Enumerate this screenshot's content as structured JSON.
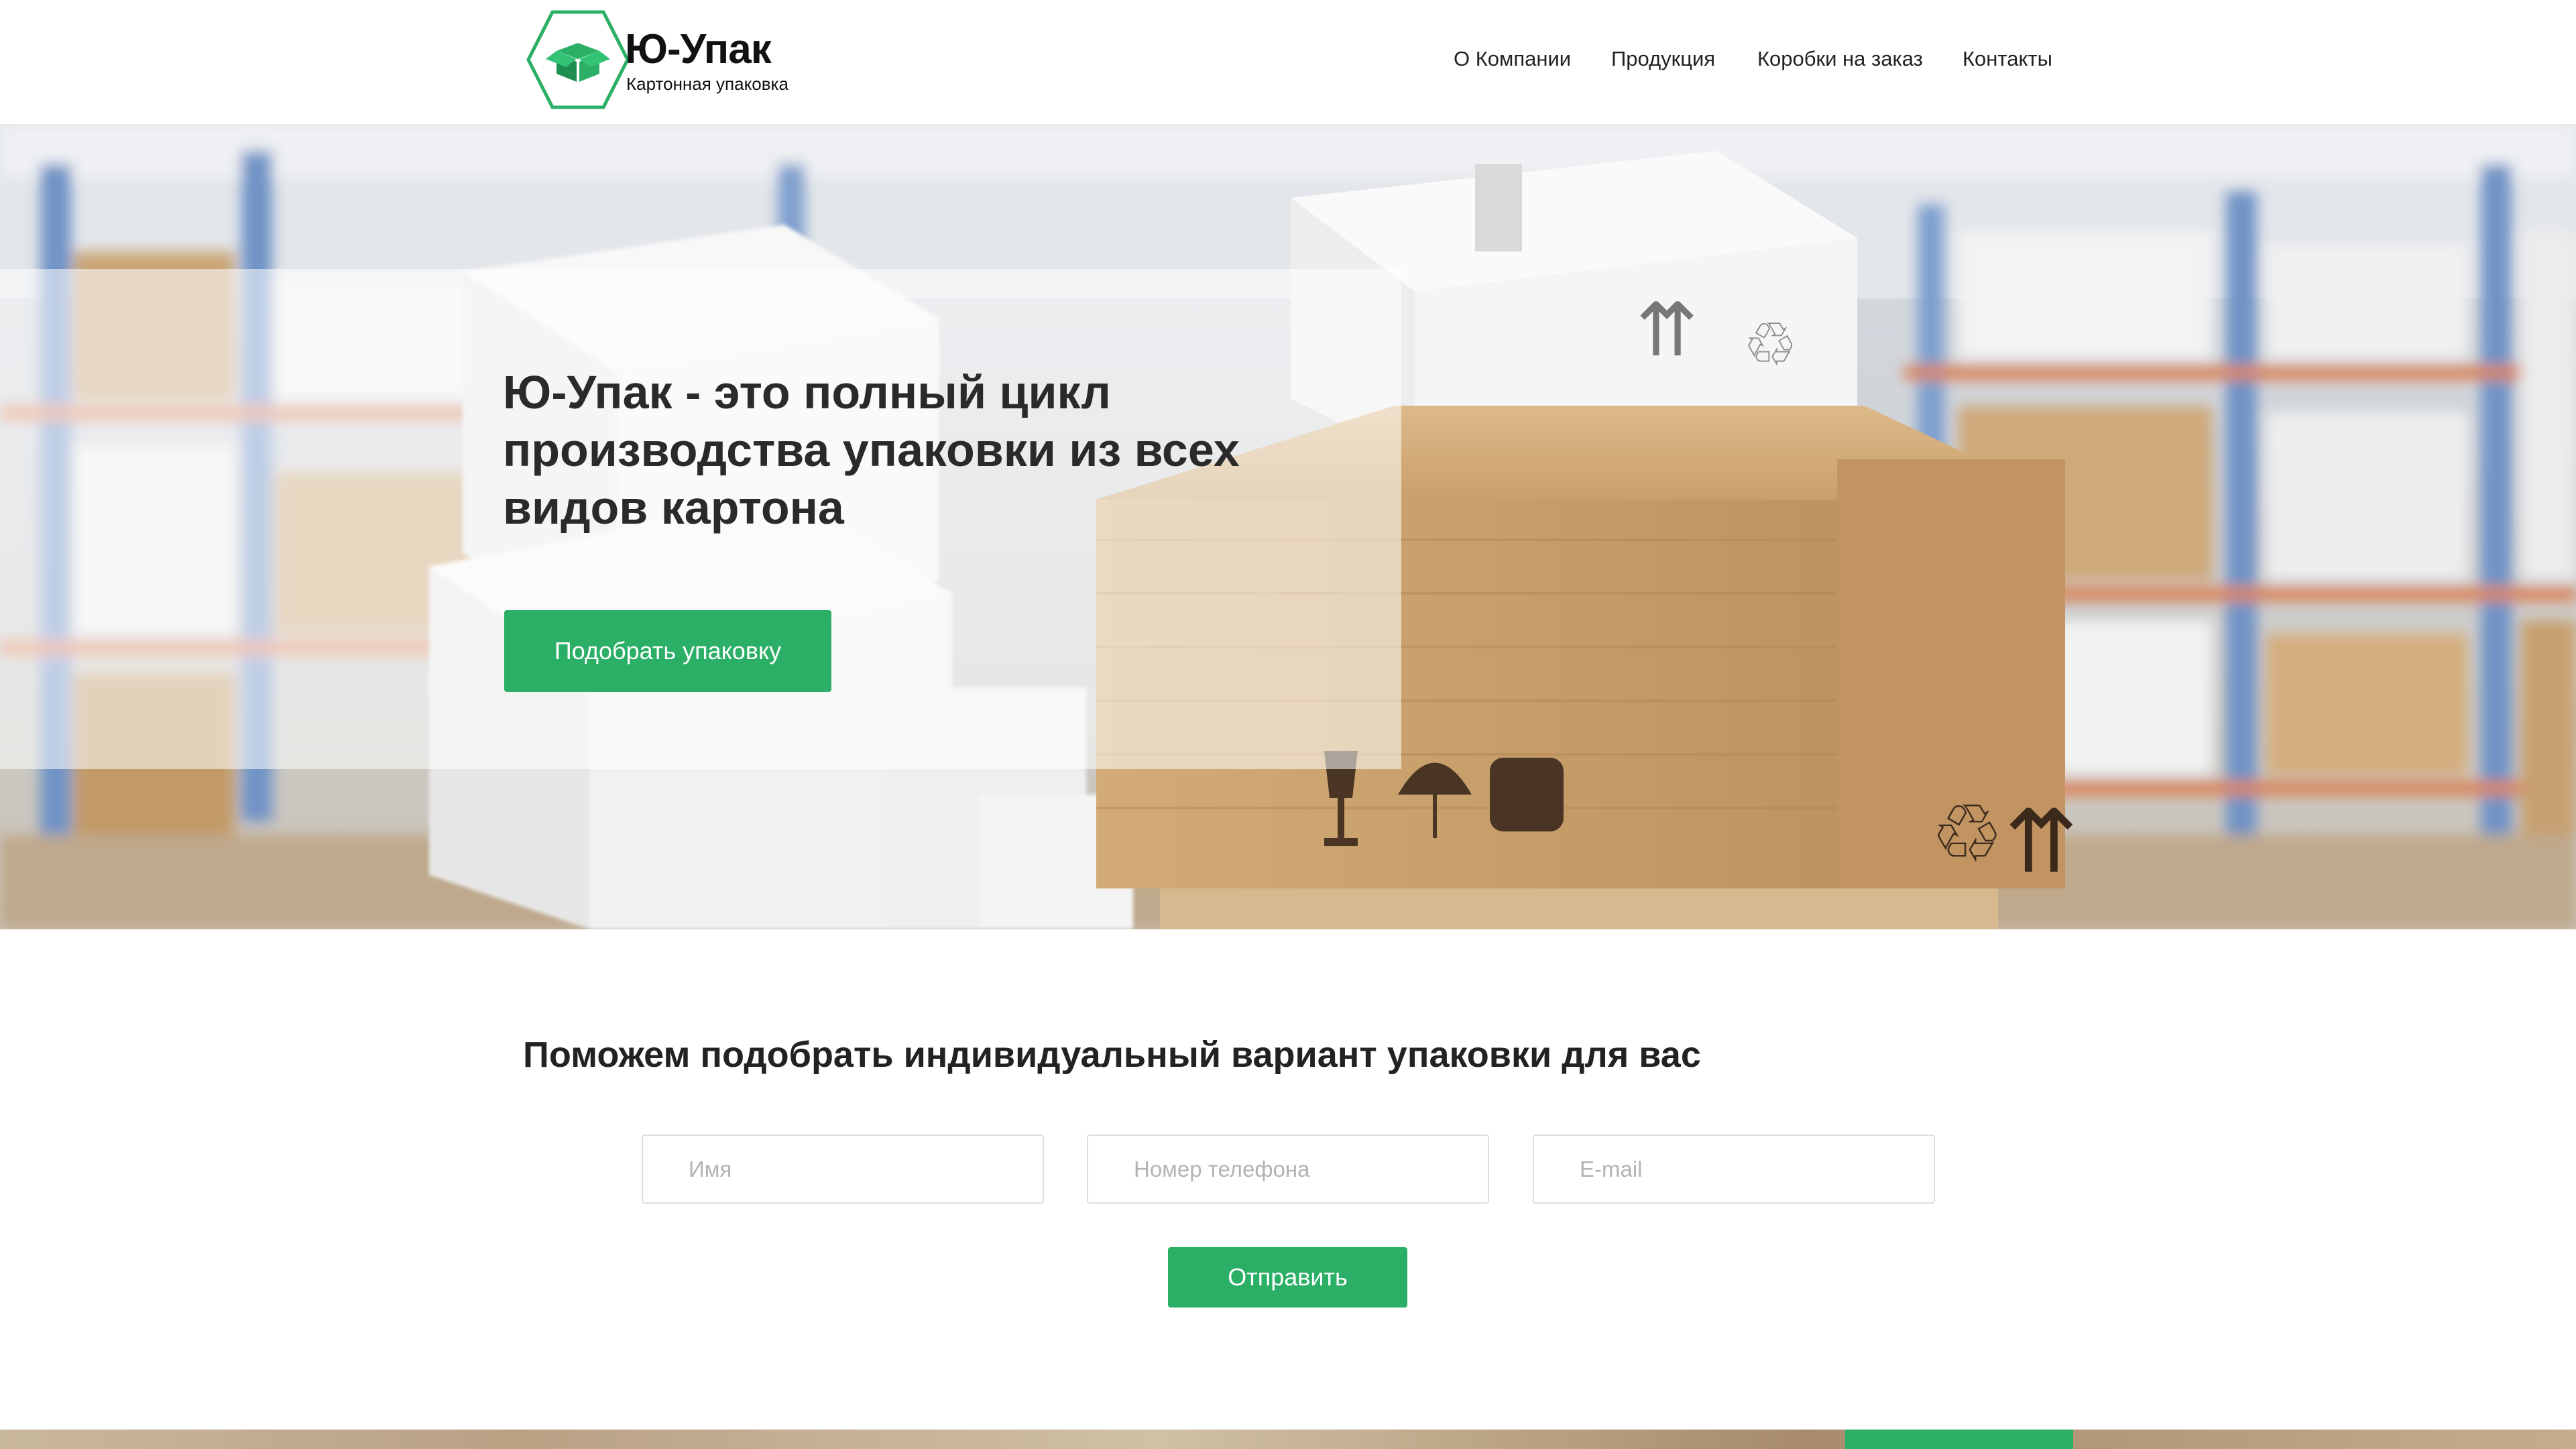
{
  "brand": {
    "name": "Ю-Упак",
    "tagline": "Картонная упаковка",
    "accent_color": "#2baf66"
  },
  "nav": {
    "items": [
      {
        "label": "О Компании"
      },
      {
        "label": "Продукция"
      },
      {
        "label": "Коробки на заказ"
      },
      {
        "label": "Контакты"
      }
    ]
  },
  "hero": {
    "title": "Ю-Упак - это полный цикл производства упаковки из всех видов картона",
    "cta_label": "Подобрать упаковку",
    "background": "warehouse-boxes-image"
  },
  "form": {
    "title": "Поможем подобрать индивидуальный вариант упаковки для вас",
    "name_placeholder": "Имя",
    "phone_placeholder": "Номер телефона",
    "email_placeholder": "E-mail",
    "submit_label": "Отправить"
  }
}
